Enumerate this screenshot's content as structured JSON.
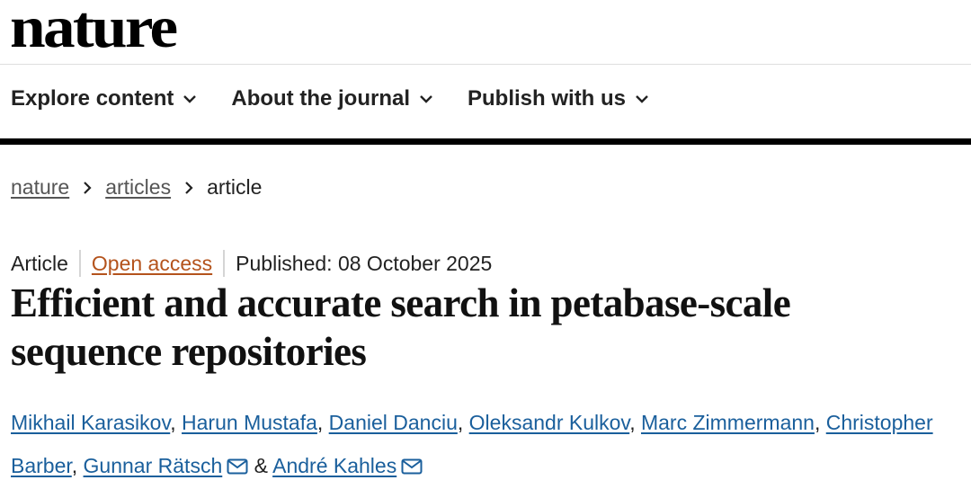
{
  "header": {
    "logo_text": "nature"
  },
  "nav": {
    "items": [
      {
        "label": "Explore content"
      },
      {
        "label": "About the journal"
      },
      {
        "label": "Publish with us"
      }
    ]
  },
  "breadcrumb": {
    "items": [
      {
        "label": "nature"
      },
      {
        "label": "articles"
      }
    ],
    "current": "article"
  },
  "article": {
    "type": "Article",
    "access": "Open access",
    "published": "Published: 08 October 2025",
    "title_line1": "Efficient and accurate search in petabase-scale",
    "title_line2": "sequence repositories",
    "authors": [
      "Mikhail Karasikov",
      "Harun Mustafa",
      "Daniel Danciu",
      "Oleksandr Kulkov",
      "Marc Zimmermann",
      "Christopher Barber",
      "Gunnar Rätsch",
      "André Kahles"
    ],
    "author_separator": ", ",
    "author_last_separator": " & "
  },
  "colors": {
    "link": "#1a5f9c",
    "open_access": "#b4531c",
    "text": "#222222"
  },
  "icons": {
    "nav_dropdown": "chevron-down-icon",
    "breadcrumb_separator": "chevron-right-icon",
    "corresponding_author": "envelope-icon"
  }
}
